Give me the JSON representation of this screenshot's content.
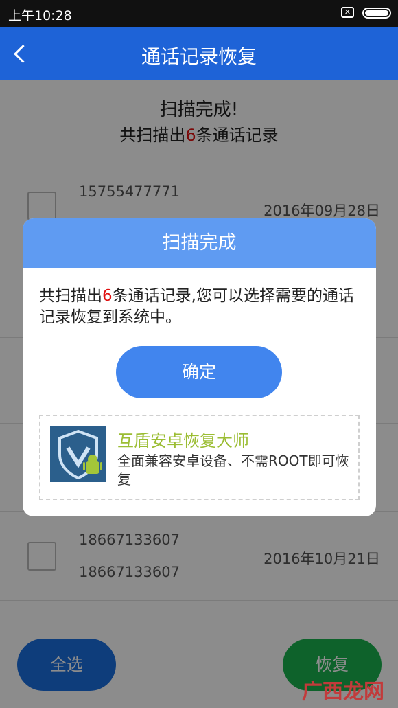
{
  "status": {
    "time": "上午10:28",
    "notif_glyph": "✕"
  },
  "appbar": {
    "title": "通话记录恢复"
  },
  "scan": {
    "title": "扫描完成!",
    "summary_prefix": "共扫描出",
    "summary_count": "6",
    "summary_suffix": "条通话记录"
  },
  "records": [
    {
      "number": "15755477771",
      "date": "2016年09月28日"
    },
    {
      "number": "18667133607",
      "number2": "18667133607",
      "date": "2016年10月21日"
    }
  ],
  "bottom": {
    "select_all": "全选",
    "restore": "恢复"
  },
  "dialog": {
    "title": "扫描完成",
    "msg_prefix": "共扫描出",
    "msg_count": "6",
    "msg_suffix": "条通话记录,您可以选择需要的通话记录恢复到系统中。",
    "ok": "确定",
    "promo_title": "互盾安卓恢复大师",
    "promo_desc": "全面兼容安卓设备、不需ROOT即可恢复"
  },
  "watermark": "广西龙网",
  "colors": {
    "appbar": "#1e63d7",
    "dialog_header": "#5f9bf2",
    "ok_button": "#4185ee",
    "count_red": "#e01010",
    "promo_title": "#9bbd33"
  }
}
